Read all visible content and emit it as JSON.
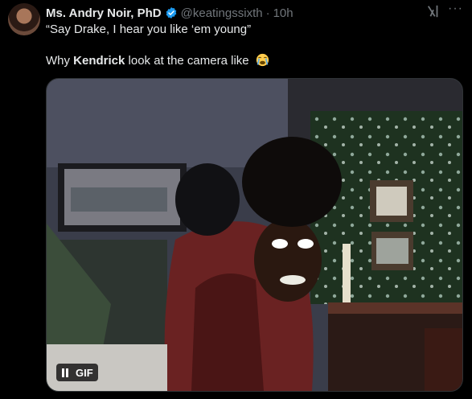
{
  "tweet": {
    "author_name": "Ms. Andry Noir, PhD",
    "handle": "@keatingssixth",
    "separator": "·",
    "time": "10h",
    "more_label": "···",
    "line1": "“Say Drake, I hear you like ‘em young”",
    "line2_prefix": "Why ",
    "line2_bold": "Kendrick",
    "line2_suffix": " look at the camera like",
    "emoji": "loudly-crying-face"
  },
  "media": {
    "gif_label": "GIF",
    "pause_icon": "pause-icon"
  },
  "colors": {
    "background": "#000000",
    "text": "#e7e9ea",
    "muted": "#71767b",
    "verified": "#1d9bf0"
  }
}
